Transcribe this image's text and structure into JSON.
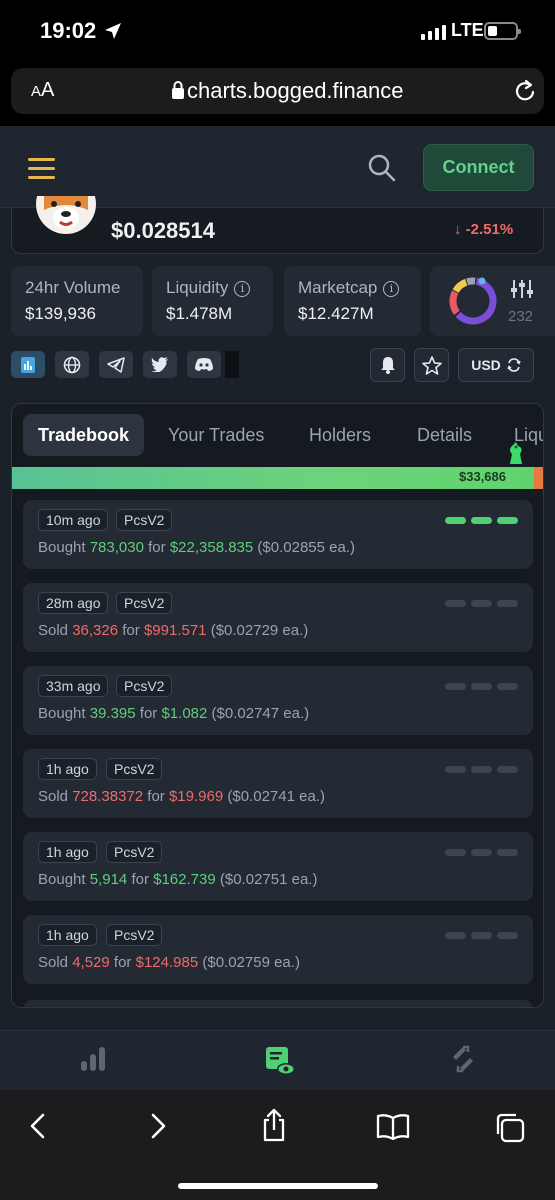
{
  "status_bar": {
    "time": "19:02",
    "network": "LTE"
  },
  "browser": {
    "aa_label_small": "A",
    "aa_label_big": "A",
    "url": "charts.bogged.finance"
  },
  "header": {
    "connect_label": "Connect"
  },
  "token": {
    "price": "$0.028514",
    "change": "-2.51%",
    "change_arrow": "↓"
  },
  "stats": [
    {
      "label": "24hr Volume",
      "value": "$139,936",
      "has_info": false
    },
    {
      "label": "Liquidity",
      "value": "$1.478M",
      "has_info": true
    },
    {
      "label": "Marketcap",
      "value": "$12.427M",
      "has_info": true
    }
  ],
  "donut_partial_text": "232",
  "currency": {
    "label": "USD"
  },
  "tabs": [
    {
      "label": "Tradebook",
      "active": true
    },
    {
      "label": "Your Trades",
      "active": false
    },
    {
      "label": "Holders",
      "active": false
    },
    {
      "label": "Details",
      "active": false
    },
    {
      "label": "Liqu",
      "active": false
    }
  ],
  "buy_sell_bar": {
    "buy_value": "$33,686",
    "buy_fraction": 0.98
  },
  "trades": [
    {
      "time": "10m ago",
      "dex": "PcsV2",
      "side": "Bought",
      "amount": "783,030",
      "total": "$22,358.835",
      "each": "($0.02855 ea.)",
      "hot": true
    },
    {
      "time": "28m ago",
      "dex": "PcsV2",
      "side": "Sold",
      "amount": "36,326",
      "total": "$991.571",
      "each": "($0.02729 ea.)",
      "hot": false
    },
    {
      "time": "33m ago",
      "dex": "PcsV2",
      "side": "Bought",
      "amount": "39.395",
      "total": "$1.082",
      "each": "($0.02747 ea.)",
      "hot": false
    },
    {
      "time": "1h ago",
      "dex": "PcsV2",
      "side": "Sold",
      "amount": "728.38372",
      "total": "$19.969",
      "each": "($0.02741 ea.)",
      "hot": false
    },
    {
      "time": "1h ago",
      "dex": "PcsV2",
      "side": "Bought",
      "amount": "5,914",
      "total": "$162.739",
      "each": "($0.02751 ea.)",
      "hot": false
    },
    {
      "time": "1h ago",
      "dex": "PcsV2",
      "side": "Sold",
      "amount": "4,529",
      "total": "$124.985",
      "each": "($0.02759 ea.)",
      "hot": false
    }
  ],
  "trade_words": {
    "for": "for"
  },
  "colors": {
    "buy": "#5fce7a",
    "sell": "#f06a6a",
    "accent": "#e9b748"
  }
}
